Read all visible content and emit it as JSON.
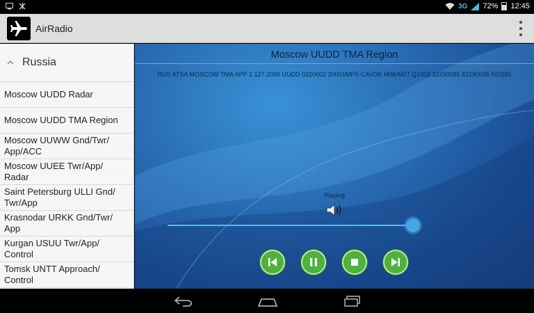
{
  "status_bar": {
    "network": "3G",
    "battery": "72%",
    "time": "12:45"
  },
  "app": {
    "title": "AirRadio",
    "icon": "airplane-icon"
  },
  "sidebar": {
    "group": "Russia",
    "items": [
      "Moscow UUDD Radar",
      "Moscow UUDD TMA Region",
      "Moscow UUWW Gnd/Twr/ App/ACC",
      "Moscow UUEE Twr/App/ Radar",
      "Saint Petersburg ULLI Gnd/ Twr/App",
      "Krasnodar URKK Gnd/Twr/ App",
      "Kurgan USUU Twr/App/ Control",
      "Tomsk UNTT Approach/ Control"
    ]
  },
  "player": {
    "station": "Moscow UUDD TMA Region",
    "metar": "RUS ATSA MOSCOW TMA APP 1 127.2000 UUDD 0220002 20001MPS CAVOK M06/M07 Q1003 32290095 82290095 NOSIG",
    "status": "Playing",
    "progress": 0.98
  },
  "controls": {
    "previous": "skip-previous-icon",
    "pause": "pause-icon",
    "stop": "stop-icon",
    "next": "skip-next-icon"
  },
  "colors": {
    "accent": "#4db23e",
    "seek": "#46a6e8"
  }
}
